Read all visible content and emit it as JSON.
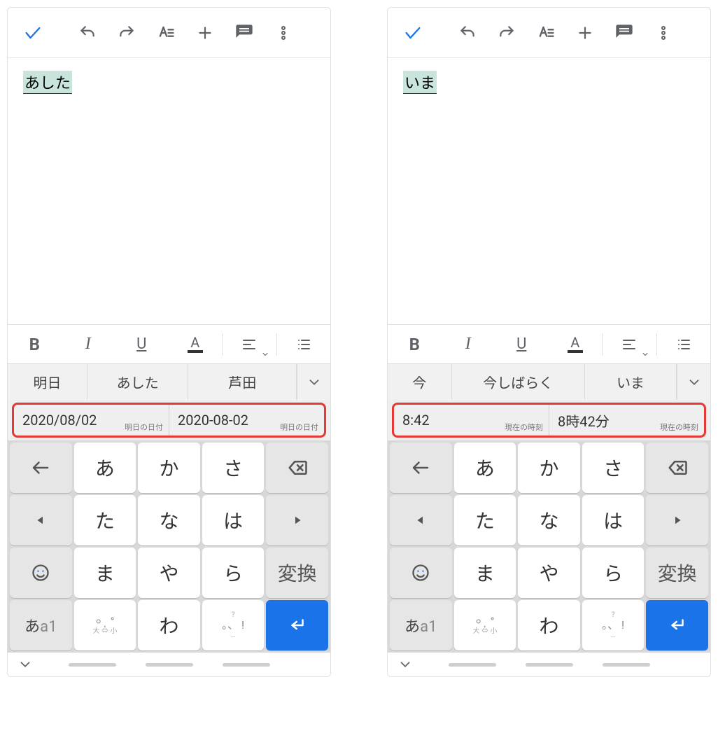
{
  "phones": [
    {
      "doc_text": "あした",
      "candidates": [
        {
          "text": "明日",
          "flex": 1
        },
        {
          "text": "あした",
          "flex": 1.3
        },
        {
          "text": "芦田",
          "flex": 1.4
        }
      ],
      "smart": [
        {
          "main": "2020/08/02",
          "sub": "明日の日付"
        },
        {
          "main": "2020-08-02",
          "sub": "明日の日付"
        }
      ]
    },
    {
      "doc_text": "いま",
      "candidates": [
        {
          "text": "今",
          "flex": 0.8
        },
        {
          "text": "今しばらく",
          "flex": 1.8
        },
        {
          "text": "いま",
          "flex": 1.2
        }
      ],
      "smart": [
        {
          "main": "8:42",
          "sub": "現在の時刻"
        },
        {
          "main": "8時42分",
          "sub": "現在の時刻"
        }
      ]
    }
  ],
  "keyboard": {
    "rows": [
      [
        "left-arrow",
        "あ",
        "か",
        "さ",
        "backspace"
      ],
      [
        "tri-left",
        "た",
        "な",
        "は",
        "tri-right"
      ],
      [
        "emoji",
        "ま",
        "や",
        "ら",
        "変換"
      ],
      [
        "mode",
        "punct",
        "わ",
        "qmark",
        "enter"
      ]
    ],
    "labels": {
      "convert": "変換",
      "mode_main": "あa1",
      "punct_main": "、。",
      "punct_sub": "大 ⇔ 小",
      "qmark_top": "?",
      "qmark_mid": "。、!",
      "qmark_bot": "...",
      "wa": "わ",
      "a": "あ",
      "ka": "か",
      "sa": "さ",
      "ta": "た",
      "na": "な",
      "ha": "は",
      "ma": "ま",
      "ya": "や",
      "ra": "ら"
    }
  }
}
